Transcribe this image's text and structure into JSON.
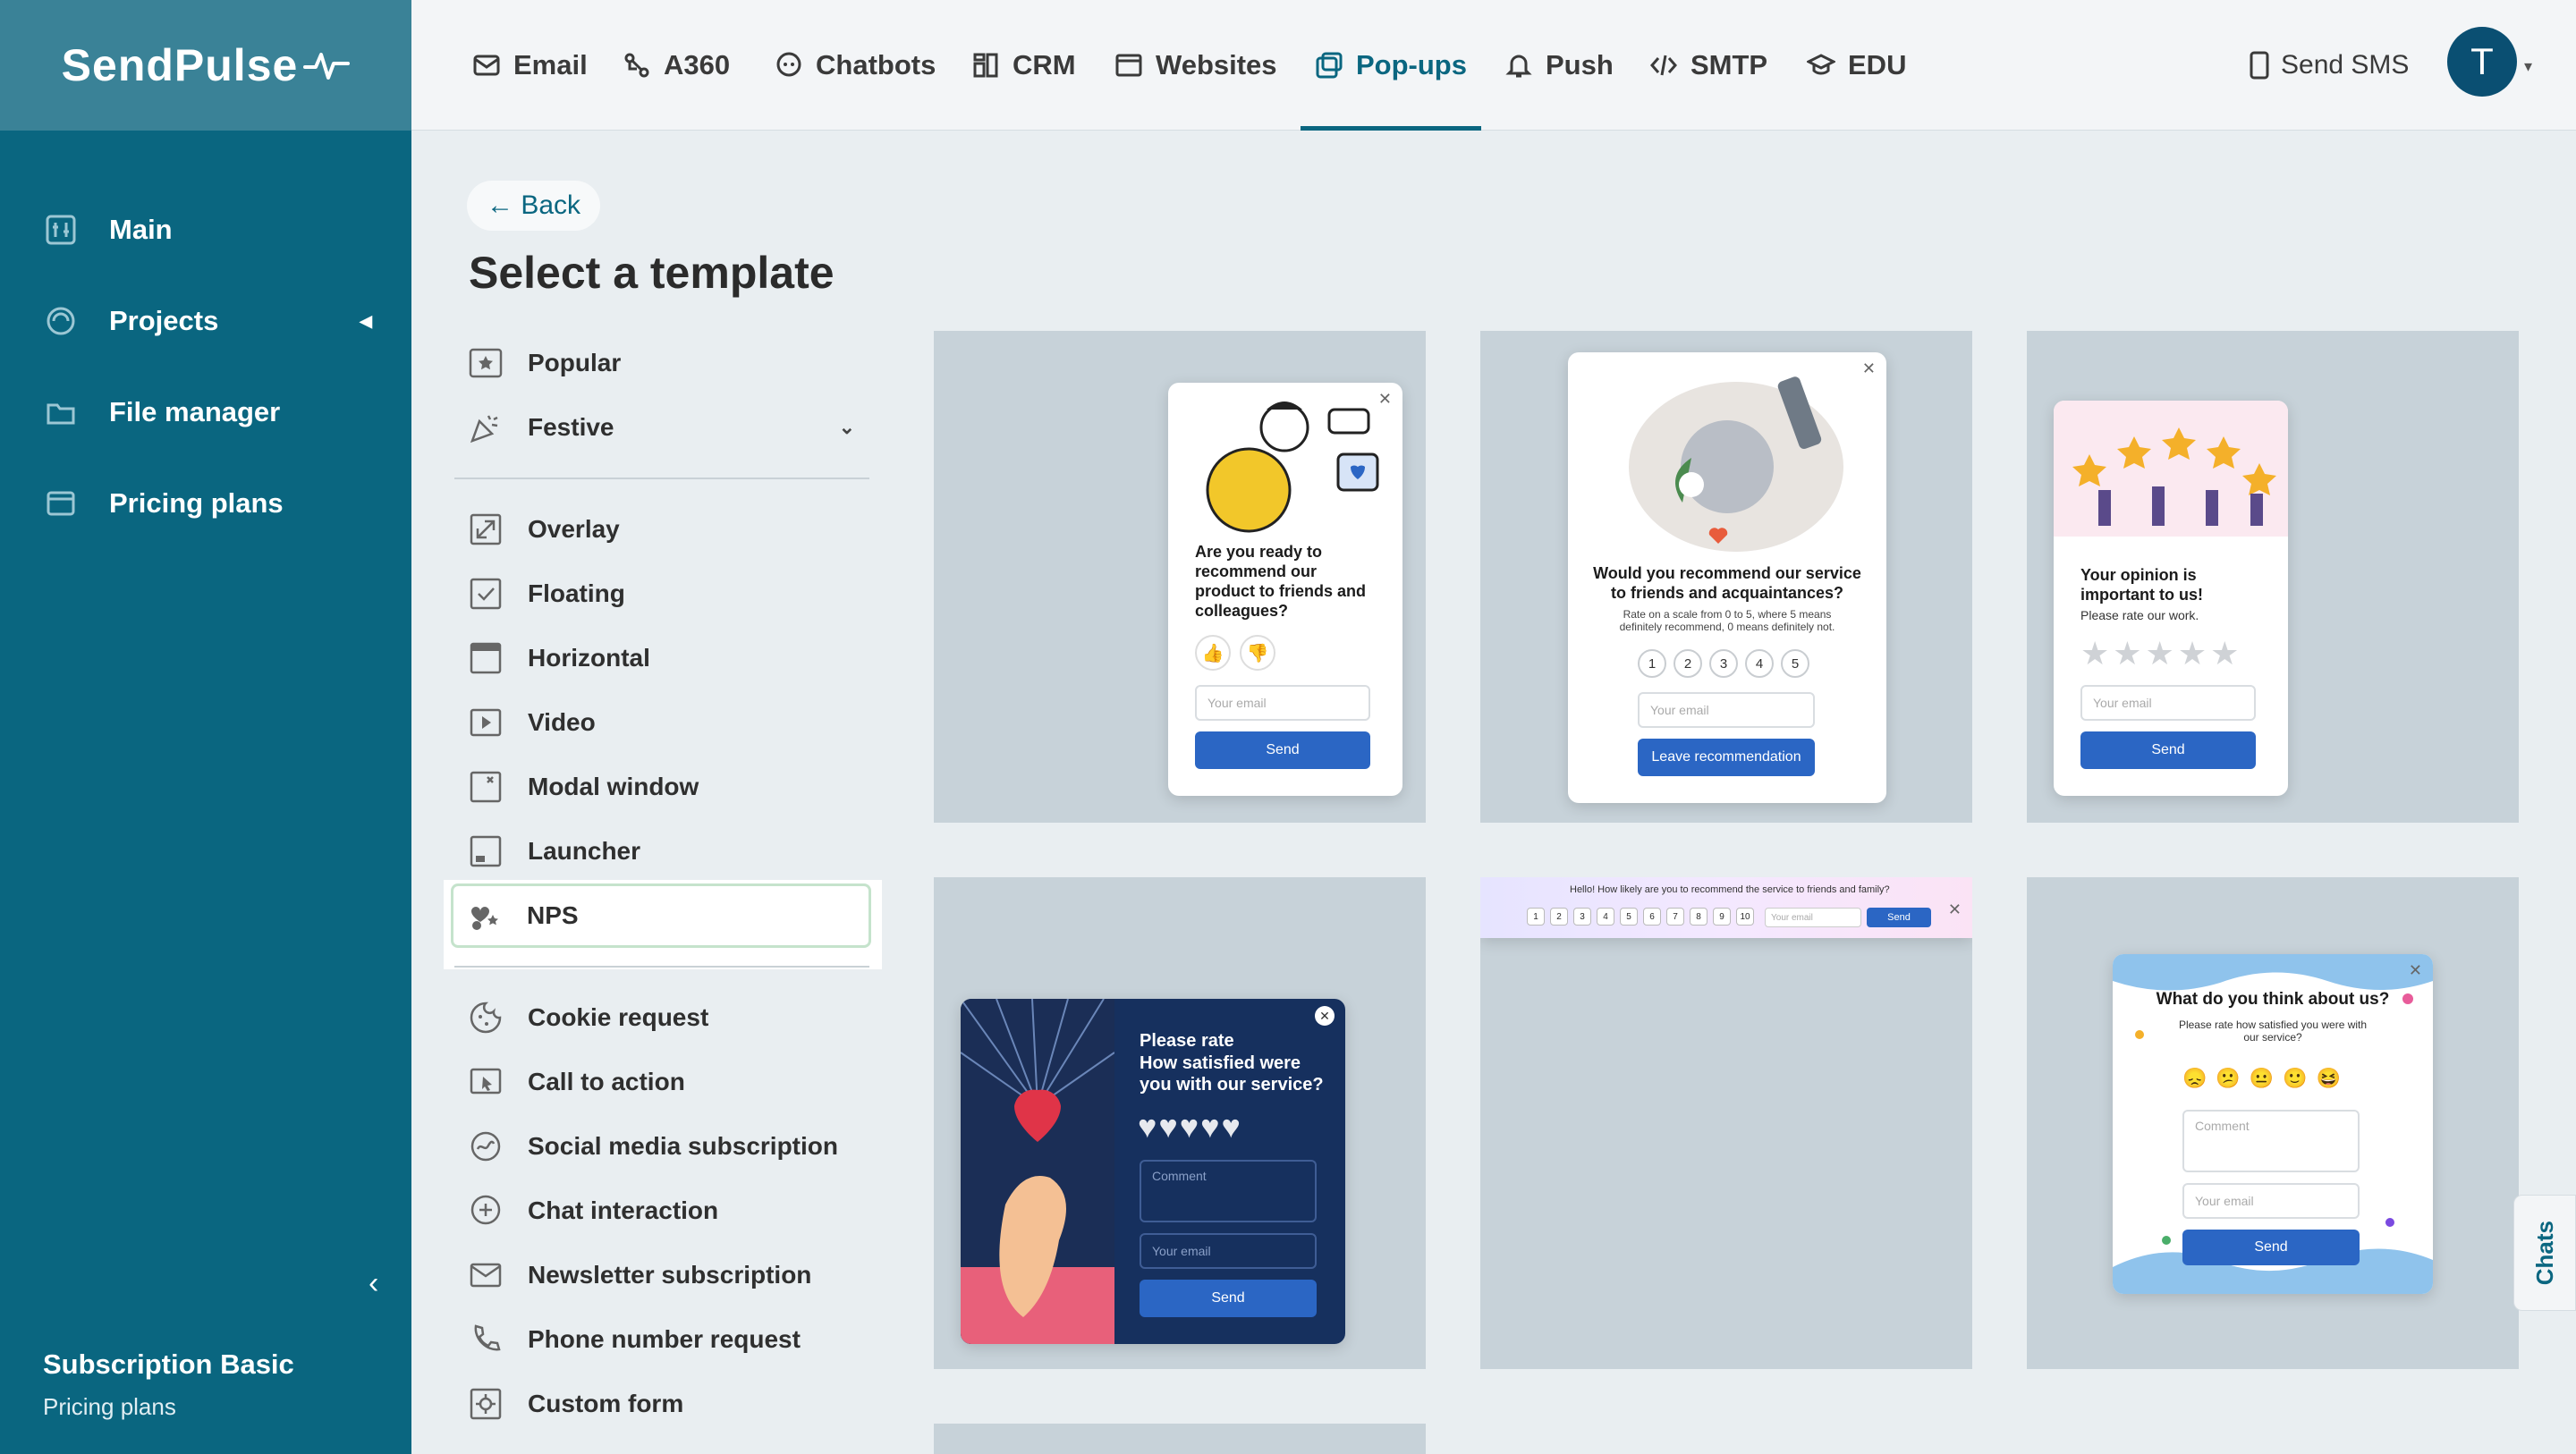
{
  "brand": {
    "name": "SendPulse"
  },
  "sidebar": {
    "items": [
      {
        "label": "Main",
        "icon": "dashboard-icon"
      },
      {
        "label": "Projects",
        "icon": "projects-icon"
      },
      {
        "label": "File manager",
        "icon": "folder-icon"
      },
      {
        "label": "Pricing plans",
        "icon": "pricing-icon"
      }
    ],
    "subscription": {
      "title": "Subscription Basic",
      "link": "Pricing plans"
    }
  },
  "topnav": {
    "items": [
      {
        "label": "Email",
        "icon": "mail-icon"
      },
      {
        "label": "A360",
        "icon": "automation-icon"
      },
      {
        "label": "Chatbots",
        "icon": "chatbot-icon"
      },
      {
        "label": "CRM",
        "icon": "crm-icon"
      },
      {
        "label": "Websites",
        "icon": "website-icon"
      },
      {
        "label": "Pop-ups",
        "icon": "popup-icon",
        "active": true
      },
      {
        "label": "Push",
        "icon": "bell-icon"
      },
      {
        "label": "SMTP",
        "icon": "code-icon"
      },
      {
        "label": "EDU",
        "icon": "graduation-icon"
      }
    ],
    "send_sms": "Send SMS",
    "avatar_letter": "T"
  },
  "content": {
    "back_label": "← Back",
    "title": "Select a template",
    "categories_top": [
      {
        "label": "Popular",
        "icon": "star-icon"
      },
      {
        "label": "Festive",
        "icon": "party-icon",
        "expandable": true
      }
    ],
    "categories": [
      {
        "label": "Overlay",
        "icon": "overlay-icon"
      },
      {
        "label": "Floating",
        "icon": "floating-icon"
      },
      {
        "label": "Horizontal",
        "icon": "horizontal-icon"
      },
      {
        "label": "Video",
        "icon": "video-icon"
      },
      {
        "label": "Modal window",
        "icon": "modal-icon"
      },
      {
        "label": "Launcher",
        "icon": "launcher-icon"
      },
      {
        "label": "NPS",
        "icon": "nps-icon",
        "selected": true
      }
    ],
    "categories_bottom": [
      {
        "label": "Cookie request",
        "icon": "cookie-icon"
      },
      {
        "label": "Call to action",
        "icon": "cta-icon"
      },
      {
        "label": "Social media subscription",
        "icon": "social-icon"
      },
      {
        "label": "Chat interaction",
        "icon": "chat-plus-icon"
      },
      {
        "label": "Newsletter subscription",
        "icon": "envelope-icon"
      },
      {
        "label": "Phone number request",
        "icon": "phone-icon"
      },
      {
        "label": "Custom form",
        "icon": "gear-icon"
      }
    ]
  },
  "templates": [
    {
      "question": "Are you ready to recommend our product to friends and colleagues?",
      "email_ph": "Your email",
      "button": "Send"
    },
    {
      "question": "Would you recommend our service to friends and acquaintances?",
      "sub": "Rate on a scale from 0 to 5, where 5 means definitely recommend, 0 means definitely not.",
      "nums": [
        "1",
        "2",
        "3",
        "4",
        "5"
      ],
      "email_ph": "Your email",
      "button": "Leave recommendation"
    },
    {
      "question": "Your opinion is important to us!",
      "sub": "Please rate our work.",
      "email_ph": "Your email",
      "button": "Send"
    },
    {
      "question1": "Please rate",
      "question2": "How satisfied were you with our service?",
      "comment_ph": "Comment",
      "email_ph": "Your email",
      "button": "Send"
    },
    {
      "question": "Hello! How likely are you to recommend the service to friends and family?",
      "nums": [
        "1",
        "2",
        "3",
        "4",
        "5",
        "6",
        "7",
        "8",
        "9",
        "10"
      ],
      "email_ph": "Your email",
      "button": "Send"
    },
    {
      "question": "What do you think about us?",
      "sub": "Please rate how satisfied you were with our service?",
      "comment_ph": "Comment",
      "email_ph": "Your email",
      "button": "Send"
    }
  ],
  "chats_label": "Chats",
  "colors": {
    "sidebar": "#0a6680",
    "accent": "#0a6680",
    "button": "#2b66c4"
  }
}
